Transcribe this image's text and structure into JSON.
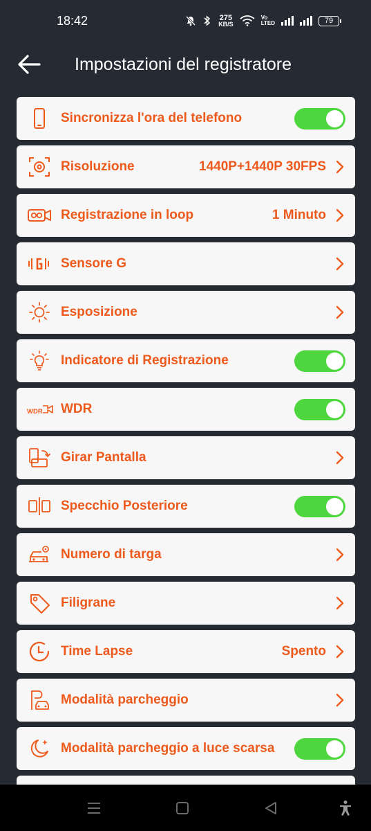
{
  "status_bar": {
    "time": "18:42",
    "net_speed_value": "275",
    "net_speed_unit": "KB/S",
    "volte_top": "Vo",
    "volte_bottom": "LTED",
    "battery": "79"
  },
  "header": {
    "title": "Impostazioni del registratore"
  },
  "settings": [
    {
      "label": "Sincronizza l'ora del telefono",
      "icon": "phone-icon",
      "control": "toggle",
      "on": true
    },
    {
      "label": "Risoluzione",
      "value": "1440P+1440P 30FPS",
      "icon": "camera-focus-icon",
      "control": "chevron"
    },
    {
      "label": "Registrazione in loop",
      "value": "1 Minuto",
      "icon": "loop-record-icon",
      "control": "chevron"
    },
    {
      "label": "Sensore G",
      "icon": "g-sensor-icon",
      "control": "chevron"
    },
    {
      "label": "Esposizione",
      "icon": "sun-icon",
      "control": "chevron"
    },
    {
      "label": "Indicatore di Registrazione",
      "icon": "lightbulb-icon",
      "control": "toggle",
      "on": true
    },
    {
      "label": "WDR",
      "icon": "wdr-icon",
      "icon_text": "WDR",
      "control": "toggle",
      "on": true
    },
    {
      "label": "Girar Pantalla",
      "icon": "rotate-screen-icon",
      "control": "chevron"
    },
    {
      "label": "Specchio Posteriore",
      "icon": "mirror-icon",
      "control": "toggle",
      "on": true
    },
    {
      "label": "Numero di targa",
      "icon": "car-settings-icon",
      "control": "chevron"
    },
    {
      "label": "Filigrane",
      "icon": "tag-icon",
      "control": "chevron"
    },
    {
      "label": "Time Lapse",
      "value": "Spento",
      "icon": "clock-icon",
      "control": "chevron"
    },
    {
      "label": "Modalità parcheggio",
      "icon": "parking-icon",
      "control": "chevron"
    },
    {
      "label": "Modalità parcheggio a luce scarsa",
      "icon": "moon-icon",
      "control": "toggle",
      "on": true
    }
  ],
  "colors": {
    "accent": "#ee5a1c",
    "toggle_on": "#4ed63f",
    "background": "#262a33",
    "row": "#f7f7f7"
  }
}
